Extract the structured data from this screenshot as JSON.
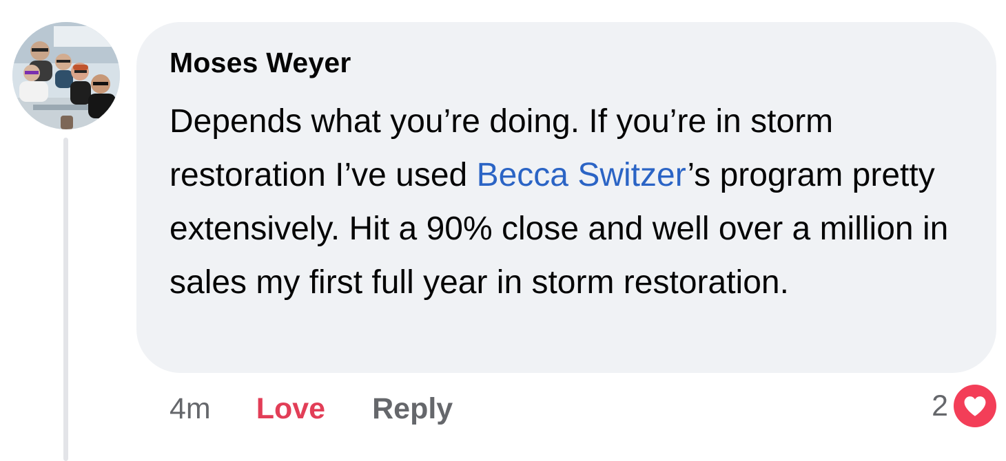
{
  "comment": {
    "author": "Moses Weyer",
    "text_before_mention": "Depends what you’re doing. If you’re in storm restoration I’ve used ",
    "mention": "Becca Switzer",
    "text_after_mention": "’s program pretty extensively. Hit a 90% close and well over a million in sales my first full year in storm restoration.",
    "avatar_icon": "profile-photo-group-icon"
  },
  "actions": {
    "timestamp": "4m",
    "love_label": "Love",
    "reply_label": "Reply"
  },
  "reactions": {
    "count": "2",
    "icon": "heart-icon",
    "color": "#f33e58"
  },
  "colors": {
    "bubble": "#f0f2f5",
    "mention": "#2b64c5",
    "love": "#e23e57",
    "secondary_text": "#65676b"
  }
}
